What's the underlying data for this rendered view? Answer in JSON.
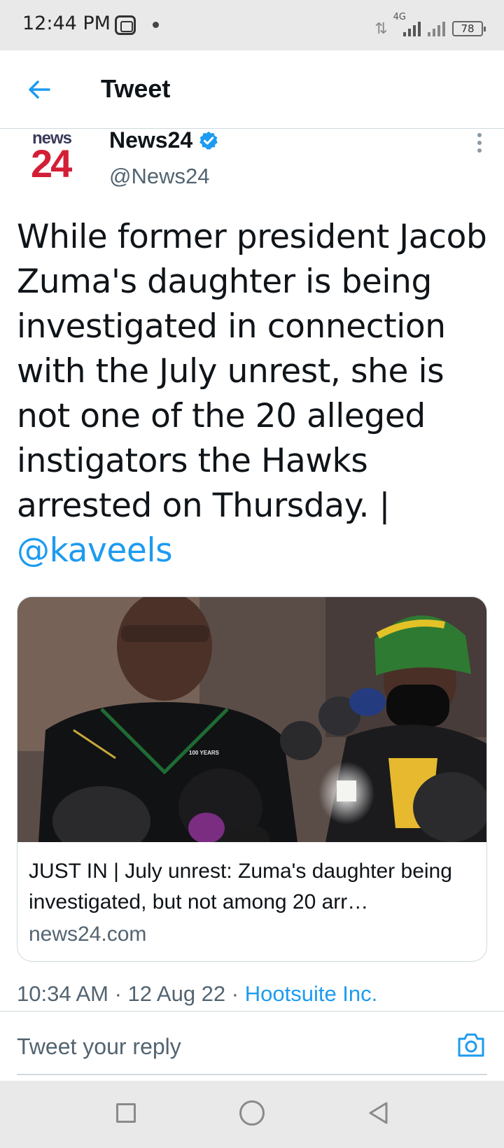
{
  "status_bar": {
    "time": "12:44 PM",
    "network": "4G",
    "battery": "78",
    "icons": [
      "app-notification-icon",
      "dot-icon",
      "data-arrows-icon",
      "signal-icon",
      "battery-icon"
    ]
  },
  "header": {
    "title": "Tweet",
    "back_icon": "back-arrow-icon"
  },
  "author": {
    "avatar_line1": "news",
    "avatar_line2": "24",
    "name": "News24",
    "handle": "@News24",
    "verified": true,
    "verified_color": "#1d9bf0"
  },
  "tweet": {
    "text": "While former president Jacob Zuma's daughter is being investigated in connection with the July unrest, she is not one of the 20 alleged instigators the Hawks arrested on Thursday. |",
    "mention": "@kaveels",
    "timestamp": "10:34 AM · 12 Aug 22 · ",
    "source": "Hootsuite Inc."
  },
  "card": {
    "headline": "JUST IN | July unrest: Zuma's daughter being investigated, but not among 20 arr…",
    "domain": "news24.com",
    "image_label": "100 YEARS"
  },
  "reply": {
    "placeholder": "Tweet your reply",
    "camera_icon": "camera-icon"
  },
  "nav": {
    "icons": [
      "recents-square-icon",
      "home-circle-icon",
      "back-triangle-icon"
    ]
  },
  "colors": {
    "accent": "#1d9bf0",
    "text_primary": "#0f1419",
    "text_secondary": "#536471",
    "brand_red": "#d31f36"
  }
}
